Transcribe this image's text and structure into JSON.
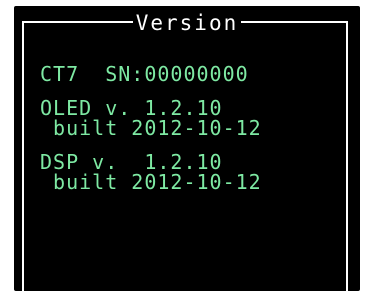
{
  "panel": {
    "title": "Version"
  },
  "device": {
    "line": "CT7  SN:00000000"
  },
  "oled": {
    "line1": "OLED v. 1.2.10",
    "line2": " built 2012-10-12"
  },
  "dsp": {
    "line1": "DSP v.  1.2.10",
    "line2": " built 2012-10-12"
  },
  "colors": {
    "screen_bg": "#000000",
    "title_text": "#ffffff",
    "info_text": "#7ee9a3"
  }
}
